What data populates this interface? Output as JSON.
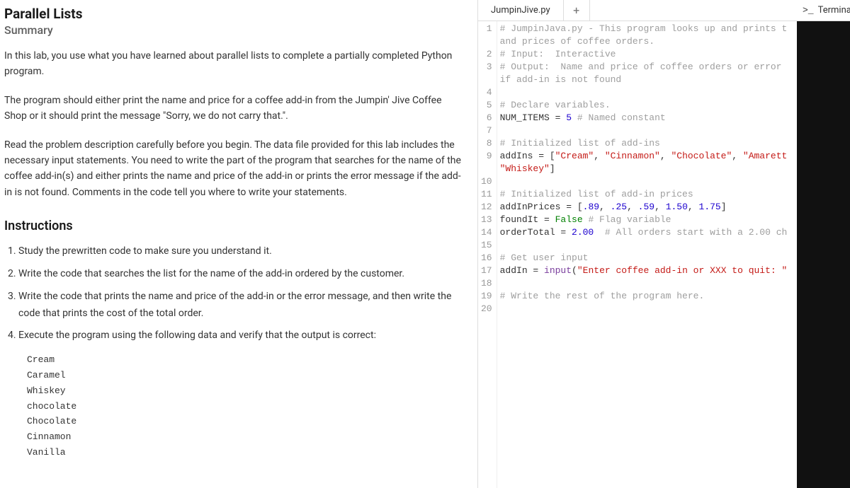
{
  "left": {
    "title": "Parallel Lists",
    "summary_heading": "Summary",
    "p1": "In this lab, you use what you have learned about parallel lists to complete a partially completed Python program.",
    "p2": "The program should either print the name and price for a coffee add-in from the Jumpin' Jive Coffee Shop or it should print the message \"Sorry, we do not carry that.\".",
    "p3": "Read the problem description carefully before you begin. The data file provided for this lab includes the necessary input statements. You need to write the part of the program that searches for the name of the coffee add-in(s) and either prints the name and price of the add-in or prints the error message if the add-in is not found. Comments in the code tell you where to write your statements.",
    "instructions_heading": "Instructions",
    "steps": [
      "Study the prewritten code to make sure you understand it.",
      "Write the code that searches the list for the name of the add-in ordered by the customer.",
      "Write the code that prints the name and price of the add-in or the error message, and then write the code that prints the cost of the total order.",
      "Execute the program using the following data and verify that the output is correct:"
    ],
    "test_data": [
      "Cream",
      "Caramel",
      "Whiskey",
      "chocolate",
      "Chocolate",
      "Cinnamon",
      "Vanilla"
    ]
  },
  "editor": {
    "tab_name": "JumpinJive.py",
    "add_label": "+",
    "code_lines": [
      {
        "n": "1",
        "segs": [
          {
            "t": "# JumpinJava.py - This program looks up and prints t",
            "c": "tok-comment"
          }
        ],
        "wrap": [
          {
            "t": "and prices of coffee orders.",
            "c": "tok-comment"
          }
        ]
      },
      {
        "n": "2",
        "segs": [
          {
            "t": "# Input:  Interactive",
            "c": "tok-comment"
          }
        ]
      },
      {
        "n": "3",
        "segs": [
          {
            "t": "# Output:  Name and price of coffee orders or error ",
            "c": "tok-comment"
          }
        ],
        "wrap": [
          {
            "t": "if add-in is not found",
            "c": "tok-comment"
          }
        ]
      },
      {
        "n": "4",
        "segs": [
          {
            "t": " ",
            "c": ""
          }
        ]
      },
      {
        "n": "5",
        "segs": [
          {
            "t": "# Declare variables.",
            "c": "tok-comment"
          }
        ]
      },
      {
        "n": "6",
        "segs": [
          {
            "t": "NUM_ITEMS = ",
            "c": ""
          },
          {
            "t": "5",
            "c": "tok-number"
          },
          {
            "t": " ",
            "c": ""
          },
          {
            "t": "# Named constant",
            "c": "tok-comment"
          }
        ]
      },
      {
        "n": "7",
        "segs": [
          {
            "t": " ",
            "c": ""
          }
        ]
      },
      {
        "n": "8",
        "segs": [
          {
            "t": "# Initialized list of add-ins",
            "c": "tok-comment"
          }
        ]
      },
      {
        "n": "9",
        "segs": [
          {
            "t": "addIns = [",
            "c": ""
          },
          {
            "t": "\"Cream\"",
            "c": "tok-string"
          },
          {
            "t": ", ",
            "c": ""
          },
          {
            "t": "\"Cinnamon\"",
            "c": "tok-string"
          },
          {
            "t": ", ",
            "c": ""
          },
          {
            "t": "\"Chocolate\"",
            "c": "tok-string"
          },
          {
            "t": ", ",
            "c": ""
          },
          {
            "t": "\"Amarett",
            "c": "tok-string"
          }
        ],
        "wrap": [
          {
            "t": "\"Whiskey\"",
            "c": "tok-string"
          },
          {
            "t": "]",
            "c": ""
          }
        ]
      },
      {
        "n": "10",
        "segs": [
          {
            "t": " ",
            "c": ""
          }
        ]
      },
      {
        "n": "11",
        "segs": [
          {
            "t": "# Initialized list of add-in prices",
            "c": "tok-comment"
          }
        ]
      },
      {
        "n": "12",
        "segs": [
          {
            "t": "addInPrices = [",
            "c": ""
          },
          {
            "t": ".89",
            "c": "tok-number"
          },
          {
            "t": ", ",
            "c": ""
          },
          {
            "t": ".25",
            "c": "tok-number"
          },
          {
            "t": ", ",
            "c": ""
          },
          {
            "t": ".59",
            "c": "tok-number"
          },
          {
            "t": ", ",
            "c": ""
          },
          {
            "t": "1.50",
            "c": "tok-number"
          },
          {
            "t": ", ",
            "c": ""
          },
          {
            "t": "1.75",
            "c": "tok-number"
          },
          {
            "t": "]",
            "c": ""
          }
        ]
      },
      {
        "n": "13",
        "segs": [
          {
            "t": "foundIt = ",
            "c": ""
          },
          {
            "t": "False",
            "c": "tok-kw"
          },
          {
            "t": " ",
            "c": ""
          },
          {
            "t": "# Flag variable",
            "c": "tok-comment"
          }
        ]
      },
      {
        "n": "14",
        "segs": [
          {
            "t": "orderTotal = ",
            "c": ""
          },
          {
            "t": "2.00",
            "c": "tok-number"
          },
          {
            "t": "  ",
            "c": ""
          },
          {
            "t": "# All orders start with a 2.00 ch",
            "c": "tok-comment"
          }
        ]
      },
      {
        "n": "15",
        "segs": [
          {
            "t": " ",
            "c": ""
          }
        ]
      },
      {
        "n": "16",
        "segs": [
          {
            "t": "# Get user input",
            "c": "tok-comment"
          }
        ]
      },
      {
        "n": "17",
        "segs": [
          {
            "t": "addIn = ",
            "c": ""
          },
          {
            "t": "input",
            "c": "tok-builtin"
          },
          {
            "t": "(",
            "c": ""
          },
          {
            "t": "\"Enter coffee add-in or XXX to quit: \"",
            "c": "tok-string"
          }
        ]
      },
      {
        "n": "18",
        "segs": [
          {
            "t": " ",
            "c": ""
          }
        ]
      },
      {
        "n": "19",
        "segs": [
          {
            "t": "# Write the rest of the program here.",
            "c": "tok-comment"
          }
        ]
      },
      {
        "n": "20",
        "segs": [
          {
            "t": " ",
            "c": ""
          }
        ]
      }
    ]
  },
  "terminal": {
    "label": "Terminal",
    "icon": ">_"
  }
}
